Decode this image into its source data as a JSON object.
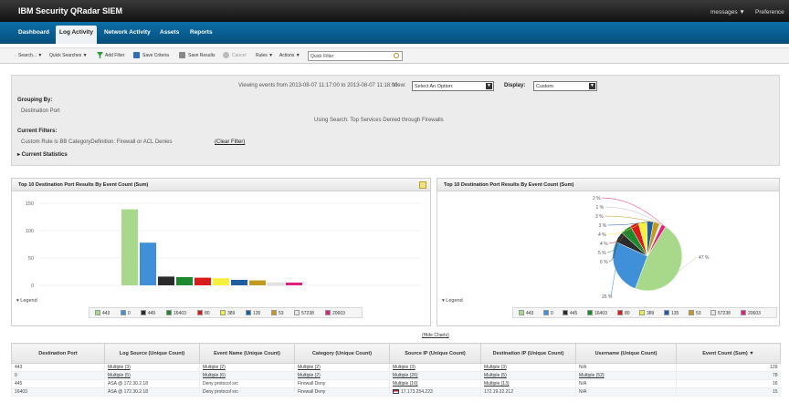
{
  "app": {
    "title": "IBM Security QRadar SIEM",
    "menu_messages": "messages ▼",
    "menu_preferences": "Preference"
  },
  "tabs": [
    {
      "label": "Dashboard"
    },
    {
      "label": "Log Activity",
      "active": true
    },
    {
      "label": "Network Activity"
    },
    {
      "label": "Assets"
    },
    {
      "label": "Reports"
    }
  ],
  "toolbar": {
    "search": "Search... ▼",
    "quick_searches": "Quick Searches ▼",
    "add_filter": "Add Filter",
    "save_criteria": "Save Criteria",
    "save_results": "Save Results",
    "cancel": "Cancel",
    "rules": "Rules ▼",
    "actions": "Actions ▼",
    "quick_filter_placeholder": "Quick Filter"
  },
  "summary": {
    "viewing": "Viewing events from 2013-08-07 11:17:00 to 2013-08-07 11:18:00",
    "view_label": "View:",
    "view_value": "Select An Option:",
    "display_label": "Display:",
    "display_value": "Custom",
    "grouping_label": "Grouping By:",
    "grouping_value": "Destination Port",
    "using_search": "Using Search: Top Services Denied through Firewalls",
    "current_filters_label": "Current Filters:",
    "filter_value": "Custom Rule is BB CategoryDefinition: Firewall or ACL Denies",
    "clear_filter": "(Clear Filter)",
    "current_statistics": "▸ Current Statistics"
  },
  "colors": {
    "c443": "#a8d98a",
    "c0": "#3f8fd9",
    "c445": "#2b2b2b",
    "c16403": "#1e8a2e",
    "c80": "#d81c1c",
    "c389": "#f5f03c",
    "c135": "#1f5ea0",
    "c53": "#c49a1e",
    "c57238": "#e9e9e9",
    "c20603": "#e0207f"
  },
  "charts": {
    "bar_title": "Top 10 Destination Port Results By Event Count (Sum)",
    "pie_title": "Top 10 Destination Port Results By Event Count (Sum)",
    "legend_label": "▾ Legend",
    "hide_charts": "(Hide Charts)"
  },
  "chart_data": [
    {
      "type": "bar",
      "title": "Top 10 Destination Port Results By Event Count (Sum)",
      "categories": [
        "443",
        "0",
        "445",
        "16403",
        "80",
        "389",
        "135",
        "53",
        "57238",
        "20603"
      ],
      "values": [
        139,
        78,
        16,
        15,
        14,
        13,
        10,
        9,
        4,
        5
      ],
      "ylim": [
        0,
        150
      ],
      "yticks": [
        0,
        50,
        100,
        150
      ],
      "grid": true,
      "legend": "bottom"
    },
    {
      "type": "pie",
      "title": "Top 10 Destination Port Results By Event Count (Sum)",
      "categories": [
        "443",
        "0",
        "445",
        "16403",
        "80",
        "389",
        "135",
        "53",
        "57238",
        "20603"
      ],
      "values": [
        47,
        26,
        5,
        5,
        4,
        4,
        3,
        3,
        1,
        2
      ],
      "labels": [
        "47 %",
        "26 %",
        "6 %",
        "5 %",
        "4 %",
        "4 %",
        "3 %",
        "3 %",
        "1 %",
        "2 %"
      ],
      "legend": "bottom"
    }
  ],
  "table": {
    "headers": [
      "Destination Port",
      "Log Source (Unique Count)",
      "Event Name (Unique Count)",
      "Category (Unique Count)",
      "Source IP (Unique Count)",
      "Destination IP (Unique Count)",
      "Username (Unique Count)",
      "Event Count (Sum) ▼"
    ],
    "rows": [
      [
        "443",
        "Multiple (3)",
        "Multiple (2)",
        "Multiple (2)",
        "Multiple (3)",
        "Multiple (3)",
        "N/A",
        "139"
      ],
      [
        "0",
        "Multiple (5)",
        "Multiple (6)",
        "Multiple (2)",
        "Multiple (26)",
        "Multiple (5)",
        "Multiple (52)",
        "78"
      ],
      [
        "445",
        "ASA @ 172.30.2.18",
        "Deny protocol src",
        "Firewall Deny",
        "Multiple (10)",
        "Multiple (13)",
        "N/A",
        "16"
      ],
      [
        "16403",
        "ASA @ 172.30.2.18",
        "Deny protocol src",
        "Firewall Deny",
        "17.173.254.223",
        "172.19.32.212",
        "N/A",
        "15"
      ]
    ]
  }
}
